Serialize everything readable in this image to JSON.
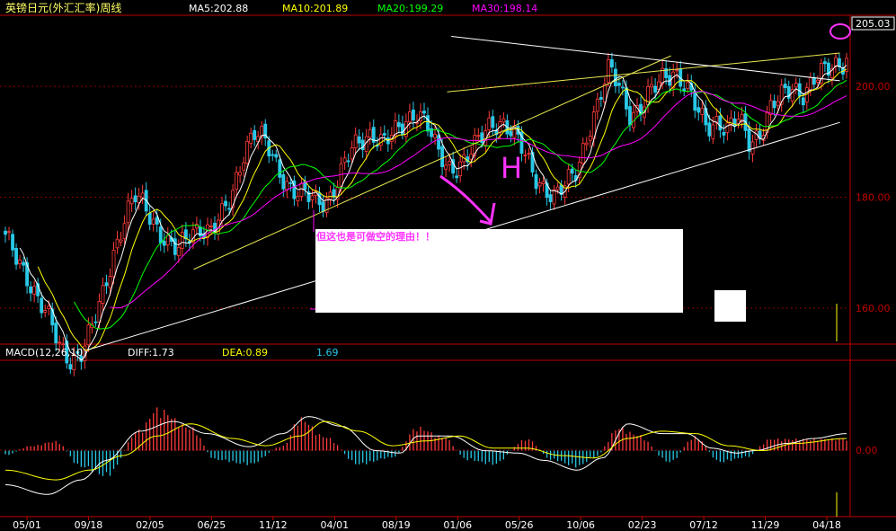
{
  "colors": {
    "background": "#000000",
    "grid": "#8b0000",
    "axis": "#c00000",
    "up": "#ff3b3b",
    "down": "#29c8e6",
    "ma5": "#ffffff",
    "ma10": "#ffff00",
    "ma20": "#00ff00",
    "ma30": "#ff00ff",
    "diff": "#ffffff",
    "dea": "#ffff00",
    "annotation": "#ff33ff",
    "trend_yellow": "#e8e850",
    "trend_white": "#ffffff"
  },
  "header": {
    "title": "英镑日元(外汇汇率)周线",
    "ma5": "MA5:202.88",
    "ma10": "MA10:201.89",
    "ma20": "MA20:199.29",
    "ma30": "MA30:198.14"
  },
  "macd_header": {
    "name": "MACD(12,26,10)",
    "diff": "DIFF:1.73",
    "dea": "DEA:0.89",
    "macd": "1.69"
  },
  "annotations": {
    "pattern_letter": "H",
    "note": "但这也是可做空的理由！！"
  },
  "chart_data": [
    {
      "type": "candlestick",
      "title": "英镑日元(外汇汇率)周线",
      "x_tick_labels": [
        "05/01",
        "09/18",
        "02/05",
        "06/25",
        "11/12",
        "04/01",
        "08/19",
        "01/06",
        "05/26",
        "10/06",
        "02/23",
        "07/12",
        "11/29",
        "04/18"
      ],
      "y_ticks": [
        160.0,
        180.0,
        200.0
      ],
      "y_tick_labels": [
        "160.00",
        "180.00",
        "200.00"
      ],
      "ylim": [
        154,
        212
      ],
      "last_price": 205.03,
      "last_price_label": "205.03",
      "moving_averages": [
        {
          "name": "MA5",
          "value": 202.88
        },
        {
          "name": "MA10",
          "value": 201.89
        },
        {
          "name": "MA20",
          "value": 199.29
        },
        {
          "name": "MA30",
          "value": 198.14
        }
      ],
      "close_path": [
        172.5,
        169,
        166,
        162,
        158,
        153,
        151,
        152,
        156,
        162,
        170,
        176,
        180,
        178,
        175,
        172,
        170,
        173,
        175,
        174,
        176,
        180,
        188,
        192,
        190,
        186,
        183,
        181,
        180,
        179,
        180,
        184,
        188,
        190,
        192,
        190,
        191,
        193,
        196,
        194,
        188,
        185,
        186,
        188,
        190,
        193,
        194,
        192,
        188,
        184,
        182,
        180,
        182,
        185,
        192,
        197,
        203,
        200,
        195,
        196,
        199,
        202,
        203,
        200,
        196,
        193,
        194,
        192,
        194,
        190,
        192,
        196,
        198,
        200,
        199,
        201,
        202.5,
        204,
        205.03
      ],
      "trendlines": [
        {
          "color": "yellow",
          "points": [
            [
              0.225,
              167
            ],
            [
              0.79,
              205.5
            ]
          ]
        },
        {
          "color": "yellow",
          "points": [
            [
              0.525,
              199
            ],
            [
              0.99,
              206
            ]
          ]
        },
        {
          "color": "white",
          "points": [
            [
              0.1,
              152.5
            ],
            [
              0.99,
              193.5
            ]
          ]
        },
        {
          "color": "white",
          "points": [
            [
              0.53,
              209
            ],
            [
              0.99,
              201
            ]
          ]
        }
      ]
    },
    {
      "type": "bar",
      "title": "MACD(12,26,10)",
      "series_labels": [
        "DIFF:1.73",
        "DEA:0.89",
        "1.69"
      ],
      "y_ticks": [
        0.0
      ],
      "y_tick_labels": [
        "0.00"
      ],
      "ylim": [
        -1.3,
        1.8
      ],
      "macd_anchors": [
        [
          0,
          -0.1
        ],
        [
          0.03,
          0.1
        ],
        [
          0.06,
          0.2
        ],
        [
          0.09,
          -0.35
        ],
        [
          0.12,
          -0.55
        ],
        [
          0.16,
          0.45
        ],
        [
          0.18,
          0.9
        ],
        [
          0.22,
          0.5
        ],
        [
          0.25,
          -0.2
        ],
        [
          0.29,
          -0.3
        ],
        [
          0.33,
          0.1
        ],
        [
          0.35,
          0.7
        ],
        [
          0.38,
          0.3
        ],
        [
          0.42,
          -0.3
        ],
        [
          0.46,
          -0.15
        ],
        [
          0.49,
          0.5
        ],
        [
          0.52,
          0.3
        ],
        [
          0.55,
          -0.2
        ],
        [
          0.58,
          -0.3
        ],
        [
          0.62,
          0.25
        ],
        [
          0.65,
          -0.2
        ],
        [
          0.68,
          -0.35
        ],
        [
          0.7,
          -0.15
        ],
        [
          0.73,
          0.5
        ],
        [
          0.75,
          0.35
        ],
        [
          0.79,
          -0.25
        ],
        [
          0.82,
          0.3
        ],
        [
          0.85,
          -0.25
        ],
        [
          0.88,
          -0.15
        ],
        [
          0.91,
          0.25
        ],
        [
          0.94,
          0.25
        ],
        [
          1.0,
          0.25
        ]
      ],
      "diff_anchors": [
        [
          0,
          -0.7
        ],
        [
          0.05,
          -0.9
        ],
        [
          0.09,
          -0.6
        ],
        [
          0.12,
          -0.2
        ],
        [
          0.16,
          0.4
        ],
        [
          0.2,
          0.6
        ],
        [
          0.24,
          0.35
        ],
        [
          0.29,
          0.08
        ],
        [
          0.33,
          0.35
        ],
        [
          0.36,
          0.7
        ],
        [
          0.4,
          0.5
        ],
        [
          0.44,
          0.0
        ],
        [
          0.47,
          -0.05
        ],
        [
          0.49,
          0.3
        ],
        [
          0.53,
          0.3
        ],
        [
          0.57,
          0.0
        ],
        [
          0.61,
          -0.05
        ],
        [
          0.64,
          -0.2
        ],
        [
          0.68,
          -0.4
        ],
        [
          0.71,
          -0.15
        ],
        [
          0.74,
          0.55
        ],
        [
          0.78,
          0.35
        ],
        [
          0.81,
          0.35
        ],
        [
          0.84,
          0.05
        ],
        [
          0.87,
          -0.05
        ],
        [
          0.89,
          0.0
        ],
        [
          0.93,
          0.15
        ],
        [
          0.96,
          0.25
        ],
        [
          1.0,
          0.35
        ]
      ],
      "dea_anchors": [
        [
          0,
          -0.4
        ],
        [
          0.06,
          -0.6
        ],
        [
          0.1,
          -0.4
        ],
        [
          0.14,
          -0.1
        ],
        [
          0.18,
          0.3
        ],
        [
          0.22,
          0.55
        ],
        [
          0.27,
          0.25
        ],
        [
          0.31,
          0.1
        ],
        [
          0.35,
          0.3
        ],
        [
          0.38,
          0.6
        ],
        [
          0.42,
          0.4
        ],
        [
          0.46,
          0.1
        ],
        [
          0.5,
          0.2
        ],
        [
          0.54,
          0.3
        ],
        [
          0.58,
          0.05
        ],
        [
          0.62,
          0.05
        ],
        [
          0.66,
          -0.1
        ],
        [
          0.7,
          -0.15
        ],
        [
          0.74,
          0.25
        ],
        [
          0.78,
          0.4
        ],
        [
          0.82,
          0.35
        ],
        [
          0.86,
          0.1
        ],
        [
          0.9,
          0.0
        ],
        [
          0.94,
          0.15
        ],
        [
          1.0,
          0.25
        ]
      ]
    }
  ]
}
